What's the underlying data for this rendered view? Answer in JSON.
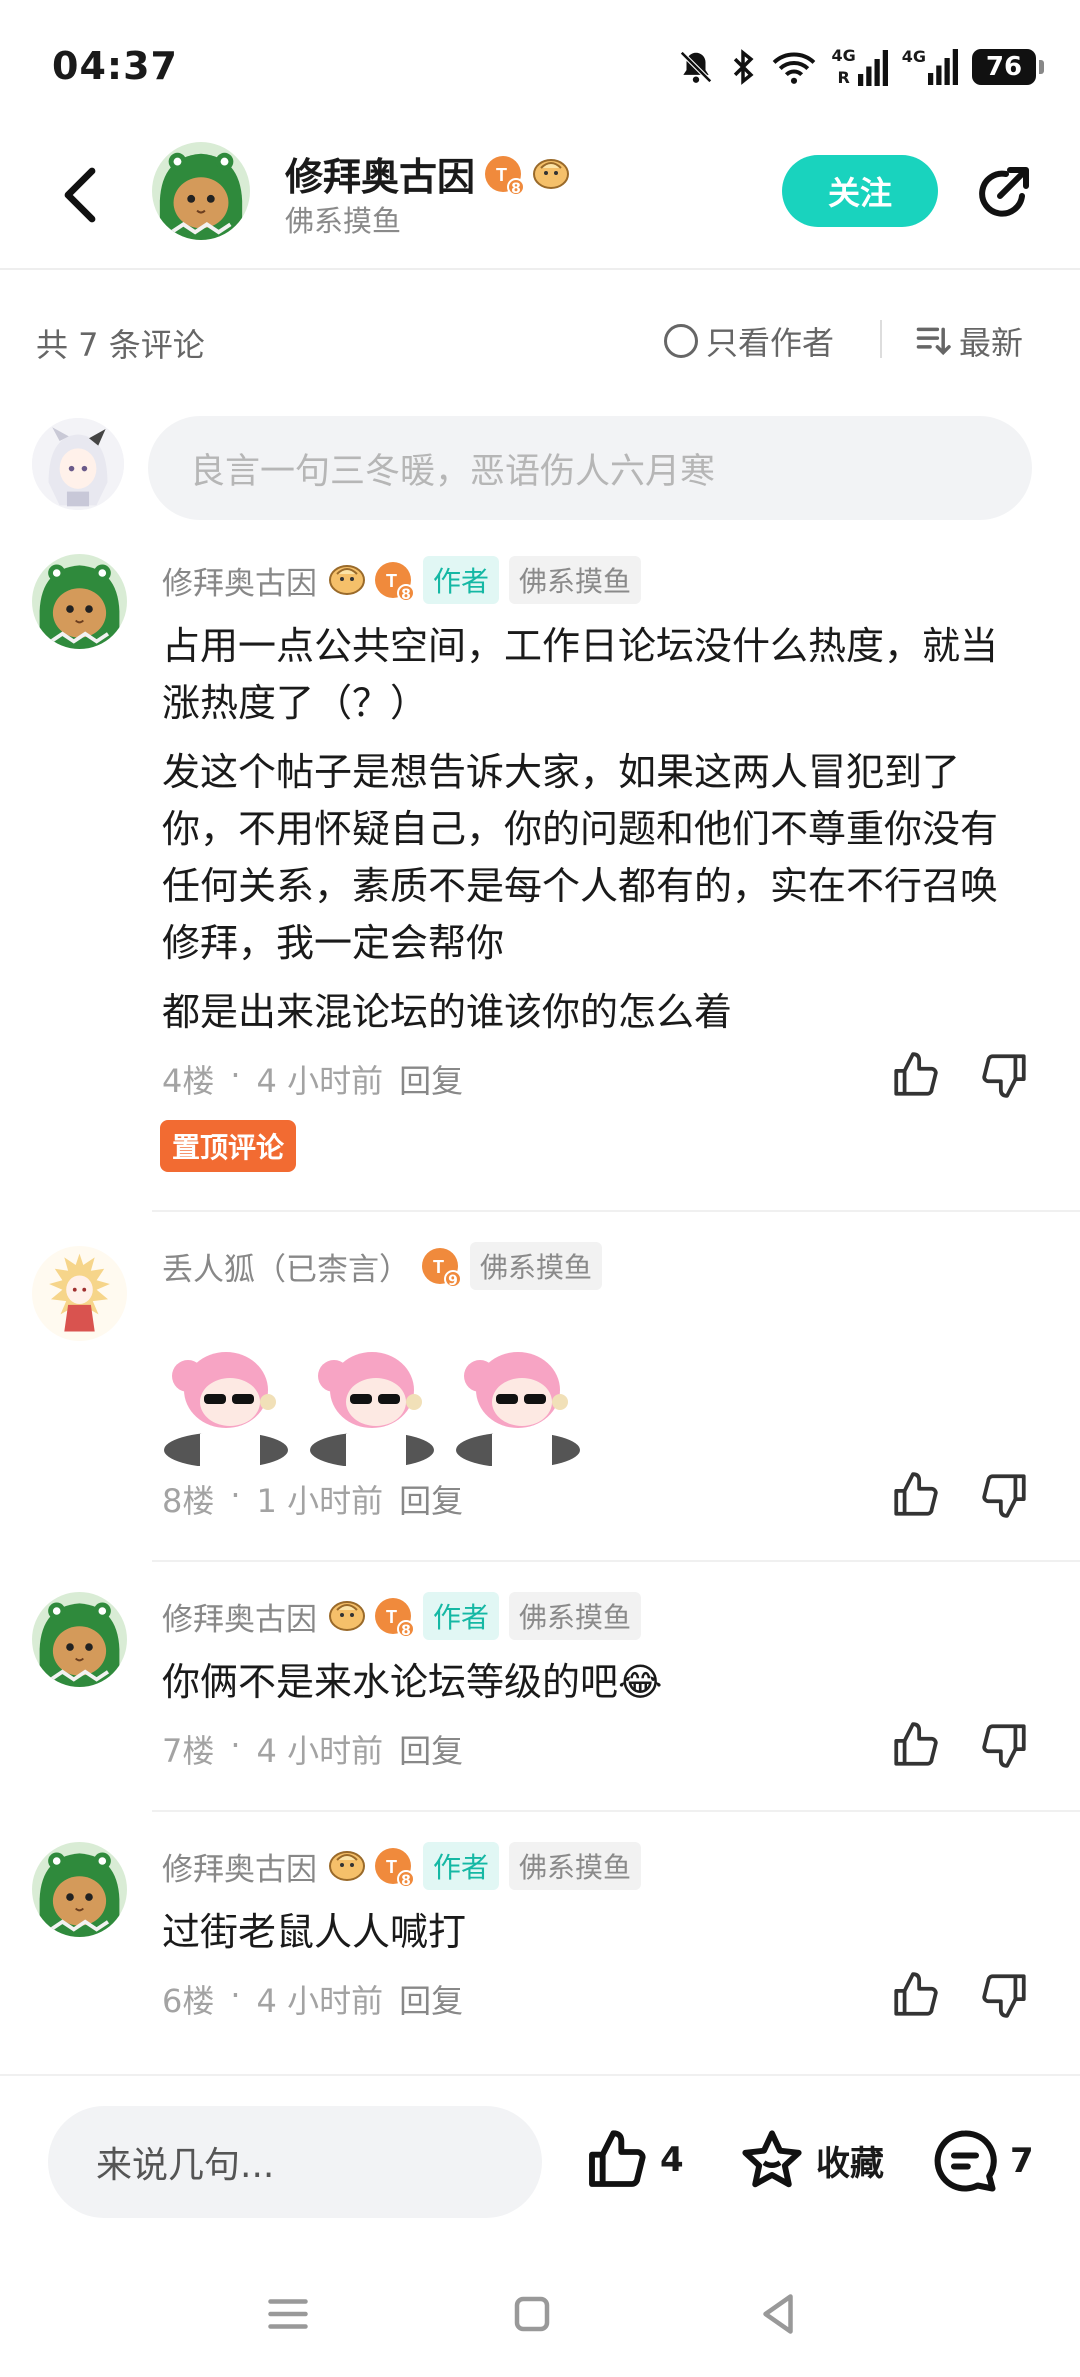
{
  "status_bar": {
    "time": "04:37",
    "net1": "4G",
    "net2": "4G",
    "roaming": "R",
    "battery": "76",
    "icons": [
      "mute-icon",
      "bluetooth-icon",
      "wifi-icon",
      "signal-icon",
      "signal-icon",
      "battery-icon"
    ]
  },
  "header": {
    "name": "修拜奥古因",
    "level_badge": "8",
    "sub": "佛系摸鱼",
    "follow_label": "关注"
  },
  "comments_bar": {
    "count_label": "共 7 条评论",
    "only_author_label": "只看作者",
    "sort_label": "最新"
  },
  "comment_input": {
    "placeholder": "良言一句三冬暖，恶语伤人六月寒"
  },
  "comments": [
    {
      "name": "修拜奥古因",
      "level": "8",
      "author_tag": "作者",
      "forum_tag": "佛系摸鱼",
      "paragraphs": [
        "占用一点公共空间，工作日论坛没什么热度，就当涨热度了（？）",
        "发这个帖子是想告诉大家，如果这两人冒犯到了你，不用怀疑自己，你的问题和他们不尊重你没有任何关系，素质不是每个人都有的，实在不行召唤修拜，我一定会帮你",
        "都是出来混论坛的谁该你的怎么着"
      ],
      "floor": "4楼",
      "time": "4 小时前",
      "reply_label": "回复",
      "pin_label": "置顶评论"
    },
    {
      "name": "丢人狐（已柰言）",
      "level": "9",
      "forum_tag": "佛系摸鱼",
      "floor": "8楼",
      "time": "1 小时前",
      "reply_label": "回复"
    },
    {
      "name": "修拜奥古因",
      "level": "8",
      "author_tag": "作者",
      "forum_tag": "佛系摸鱼",
      "text": "你俩不是来水论坛等级的吧😂",
      "floor": "7楼",
      "time": "4 小时前",
      "reply_label": "回复"
    },
    {
      "name": "修拜奥古因",
      "level": "8",
      "author_tag": "作者",
      "forum_tag": "佛系摸鱼",
      "text": "过街老鼠人人喊打",
      "floor": "6楼",
      "time": "4 小时前",
      "reply_label": "回复"
    }
  ],
  "bottom_bar": {
    "input_placeholder": "来说几句...",
    "like_count": "4",
    "collect_label": "收藏",
    "comment_count": "7"
  },
  "colors": {
    "accent": "#19d3be",
    "pin": "#f26b32",
    "level_badge": "#f08a3c"
  }
}
